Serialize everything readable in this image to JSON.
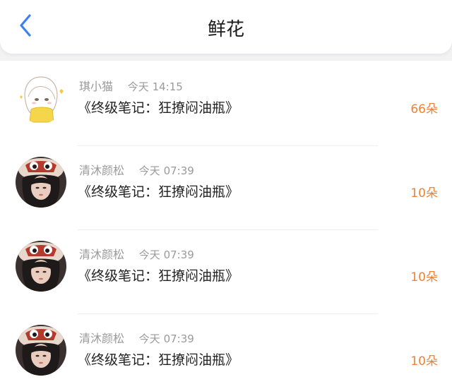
{
  "header": {
    "title": "鲜花",
    "back_icon": "chevron-left-icon",
    "accent_color": "#3d7ff5"
  },
  "list": {
    "items": [
      {
        "user": "琪小猫",
        "time": "今天 14:15",
        "book": "《终级笔记：狂撩闷油瓶》",
        "count": "66朵",
        "avatar": "cartoon-girl-avatar"
      },
      {
        "user": "清沐颜松",
        "time": "今天 07:39",
        "book": "《终级笔记：狂撩闷油瓶》",
        "count": "10朵",
        "avatar": "girl-photo-avatar"
      },
      {
        "user": "清沐颜松",
        "time": "今天 07:39",
        "book": "《终级笔记：狂撩闷油瓶》",
        "count": "10朵",
        "avatar": "girl-photo-avatar"
      },
      {
        "user": "清沐颜松",
        "time": "今天 07:39",
        "book": "《终级笔记：狂撩闷油瓶》",
        "count": "10朵",
        "avatar": "girl-photo-avatar"
      }
    ]
  },
  "colors": {
    "count_color": "#e8843d",
    "meta_color": "#9a9a9a"
  }
}
